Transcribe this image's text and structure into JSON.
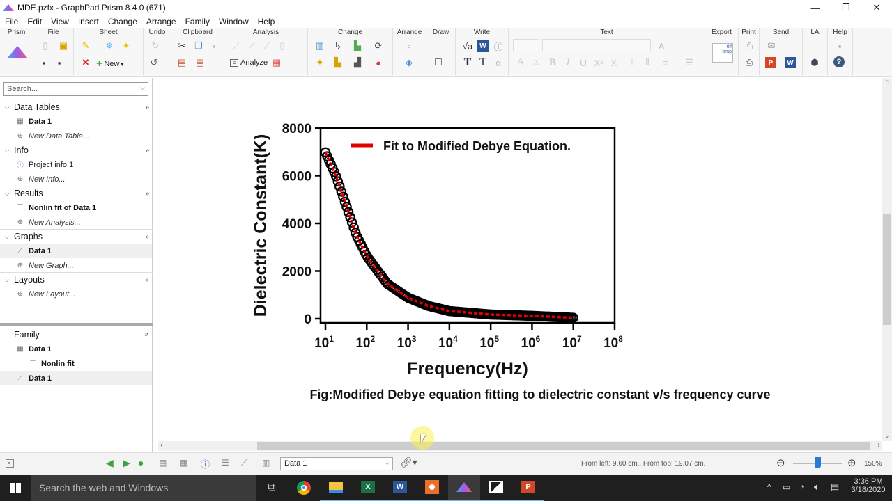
{
  "window": {
    "title": "MDE.pzfx - GraphPad Prism 8.4.0 (671)",
    "minimize": "—",
    "restore": "❐",
    "close": "✕"
  },
  "menu": [
    "File",
    "Edit",
    "View",
    "Insert",
    "Change",
    "Arrange",
    "Family",
    "Window",
    "Help"
  ],
  "ribbon": {
    "groups": [
      "Prism",
      "File",
      "Sheet",
      "Undo",
      "Clipboard",
      "Analysis",
      "Change",
      "Arrange",
      "Draw",
      "Write",
      "Text",
      "Export",
      "Print",
      "Send",
      "LA",
      "Help"
    ],
    "new_label": "New",
    "analyze_label": "Analyze"
  },
  "sidebar": {
    "search_placeholder": "Search...",
    "sections": [
      {
        "label": "Data Tables",
        "items": [
          {
            "label": "Data 1",
            "bold": true,
            "icon": "table-icon"
          },
          {
            "label": "New Data Table...",
            "italic": true,
            "icon": "plus-circle-icon"
          }
        ]
      },
      {
        "label": "Info",
        "items": [
          {
            "label": "Project info 1",
            "icon": "info-icon"
          },
          {
            "label": "New Info...",
            "italic": true,
            "icon": "plus-circle-icon"
          }
        ]
      },
      {
        "label": "Results",
        "items": [
          {
            "label": "Nonlin fit of Data 1",
            "bold": true,
            "icon": "results-icon"
          },
          {
            "label": "New Analysis...",
            "italic": true,
            "icon": "plus-circle-icon"
          }
        ]
      },
      {
        "label": "Graphs",
        "items": [
          {
            "label": "Data 1",
            "bold": true,
            "icon": "graph-icon",
            "selected": true
          },
          {
            "label": "New Graph...",
            "italic": true,
            "icon": "plus-circle-icon"
          }
        ]
      },
      {
        "label": "Layouts",
        "items": [
          {
            "label": "New Layout...",
            "italic": true,
            "icon": "plus-circle-icon"
          }
        ]
      }
    ],
    "more": "»",
    "family": {
      "label": "Family",
      "items": [
        {
          "label": "Data 1",
          "icon": "table-icon"
        },
        {
          "label": "Nonlin fit",
          "icon": "results-icon"
        },
        {
          "label": "Data 1",
          "icon": "graph-icon",
          "selected": true
        }
      ]
    }
  },
  "figure_caption": "Fig:Modified Debye equation fitting to dielectric constant v/s frequency curve",
  "chart_data": {
    "type": "scatter",
    "title": "",
    "xlabel": "Frequency(Hz)",
    "ylabel": "Dielectric Constant(K)",
    "x_scale": "log10",
    "xlim": [
      10,
      100000000
    ],
    "ylim": [
      0,
      8000
    ],
    "x_ticks": [
      "10^1",
      "10^2",
      "10^3",
      "10^4",
      "10^5",
      "10^6",
      "10^7",
      "10^8"
    ],
    "x_tick_exponents": [
      1,
      2,
      3,
      4,
      5,
      6,
      7,
      8
    ],
    "y_ticks": [
      0,
      2000,
      4000,
      6000,
      8000
    ],
    "grid": false,
    "legend": {
      "position": "top-right",
      "entries": [
        {
          "label": "Fit to Modified Debye Equation.",
          "color": "#e00000",
          "type": "line"
        }
      ]
    },
    "series": [
      {
        "name": "Data 1",
        "marker": "open-circle",
        "color": "#000000",
        "x_log10": [
          1.0,
          1.25,
          1.5,
          1.75,
          2.0,
          2.5,
          3.0,
          3.5,
          4.0,
          5.0,
          6.0,
          7.0
        ],
        "y": [
          6980,
          6010,
          4760,
          3500,
          2630,
          1460,
          880,
          530,
          320,
          175,
          120,
          40
        ]
      },
      {
        "name": "Fit to Modified Debye Equation.",
        "marker": "line",
        "color": "#e00000",
        "x_log10": [
          1.0,
          1.25,
          1.5,
          1.75,
          2.0,
          2.5,
          3.0,
          3.5,
          4.0,
          5.0,
          6.0,
          7.0
        ],
        "y": [
          6980,
          6010,
          4760,
          3500,
          2630,
          1460,
          880,
          530,
          320,
          175,
          120,
          40
        ]
      }
    ]
  },
  "bottom_bar": {
    "sheet_select": "Data 1",
    "position": "From left: 9.60 cm., From top: 19.07 cm.",
    "zoom": "150%",
    "zoom_fraction": 0.5
  },
  "taskbar": {
    "search": "Search the web and Windows",
    "time": "3:36 PM",
    "date": "3/18/2020"
  }
}
